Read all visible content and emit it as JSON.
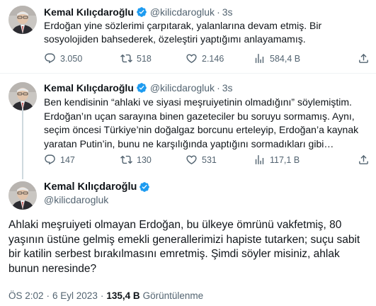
{
  "author": {
    "name": "Kemal Kılıçdaroğlu",
    "handle": "@kilicdarogluk"
  },
  "tweets": [
    {
      "time": "3s",
      "lines": [
        "Erdoğan yine sözlerimi çarpıtarak, yalanlarına devam etmiş. Bir",
        "sosyolojiden bahsederek, özeleştiri yaptığımı anlayamamış."
      ],
      "replies": "3.050",
      "retweets": "518",
      "likes": "2.146",
      "views": "584,4 B"
    },
    {
      "time": "3s",
      "lines": [
        "Ben kendisinin “ahlaki ve siyasi meşruiyetinin olmadığını” söylemiştim.",
        "Erdoğan’ın uçan sarayına binen gazeteciler bu soruyu sormamış. Aynı,",
        "seçim öncesi Türkiye’nin doğalgaz borcunu erteleyip, Erdoğan’a kaynak",
        "yaratan Putin’in, bunu ne karşılığında yaptığını sormadıkları gibi…"
      ],
      "replies": "147",
      "retweets": "130",
      "likes": "531",
      "views": "117,1 B"
    }
  ],
  "main_tweet": {
    "lines": [
      "Ahlaki meşruiyeti olmayan Erdoğan, bu ülkeye ömrünü vakfetmiş, 80",
      "yaşının üstüne gelmiş emekli generallerimizi hapiste tutarken; suçu sabit",
      "bir katilin serbest bırakılmasını emretmiş. Şimdi söyler misiniz, ahlak",
      "bunun neresinde?"
    ],
    "time": "ÖS 2:02",
    "date": "6 Eyl 2023",
    "views_count": "135,4 B",
    "views_label": "Görüntülenme"
  },
  "colors": {
    "text": "#0f1419",
    "secondary": "#536471",
    "verified": "#1d9bf0",
    "thread_line": "#cfd9de",
    "divider": "#eff3f4"
  },
  "icons": [
    "verified-badge-icon",
    "reply-icon",
    "retweet-icon",
    "like-icon",
    "views-icon",
    "share-icon"
  ]
}
